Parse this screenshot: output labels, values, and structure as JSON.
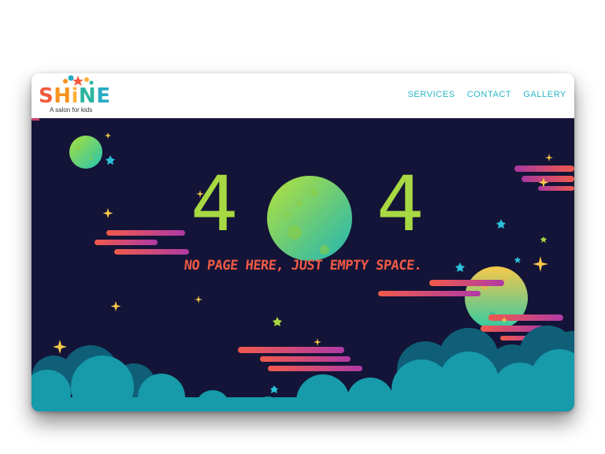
{
  "brand": {
    "name_parts": [
      "S",
      "H",
      "i",
      "N",
      "E"
    ],
    "name_colors": [
      "#f05a3c",
      "#f7931e",
      "#fbb03b",
      "#2bb5a0",
      "#27aac4"
    ],
    "tagline": "A salon for kids",
    "star_color": "#f7931e"
  },
  "nav": {
    "items": [
      "SERVICES",
      "CONTACT",
      "GALLERY"
    ],
    "color": "#27b7c4"
  },
  "error": {
    "code_left": "4",
    "code_right": "4",
    "message": "NO PAGE HERE, JUST EMPTY SPACE."
  },
  "colors": {
    "sky": "#131437",
    "digits": "#a8d842",
    "message": "#ef5a45",
    "clouds_back": "#0f5f78",
    "clouds_front": "#179aa9"
  },
  "icons": [
    "star-icon",
    "sparkle-icon",
    "planet-icon",
    "moon-icon"
  ]
}
